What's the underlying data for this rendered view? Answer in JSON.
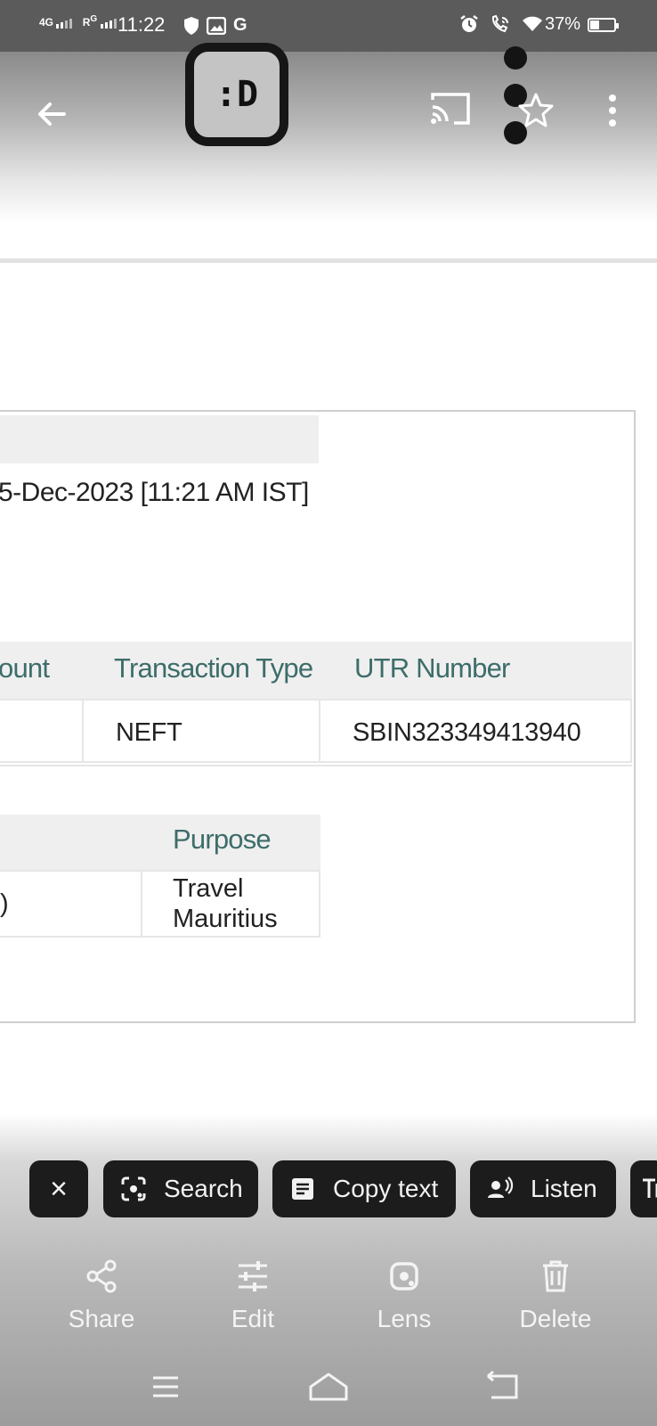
{
  "status_bar": {
    "network_1": "4G",
    "network_2": "R",
    "network_2_sup": "G",
    "time": "11:22",
    "g_label": "G",
    "battery": "37%",
    "battery_level": 0.37
  },
  "top_bar": {
    "logo_text": ":D",
    "icons": [
      "back-arrow-icon",
      "cast-icon",
      "star-icon",
      "more-vert-icon"
    ]
  },
  "document": {
    "date_text": "5-Dec-2023 [11:21 AM IST]",
    "table1": {
      "headers": [
        "ount",
        "Transaction Type",
        "UTR Number"
      ],
      "row": [
        "",
        "NEFT",
        "SBIN323349413940"
      ]
    },
    "table2": {
      "headers": [
        "",
        "Purpose"
      ],
      "row_left": ")",
      "purpose_lines": [
        "Travel",
        "Mauritius"
      ]
    }
  },
  "chips": {
    "close_label": "×",
    "search_label": "Search",
    "copy_label": "Copy text",
    "listen_label": "Listen"
  },
  "actions": {
    "share_label": "Share",
    "edit_label": "Edit",
    "lens_label": "Lens",
    "delete_label": "Delete"
  },
  "colors": {
    "header_teal": "#3d6d6a",
    "chip_bg": "#1c1c1c",
    "status_bar": "#5b5b5b"
  }
}
